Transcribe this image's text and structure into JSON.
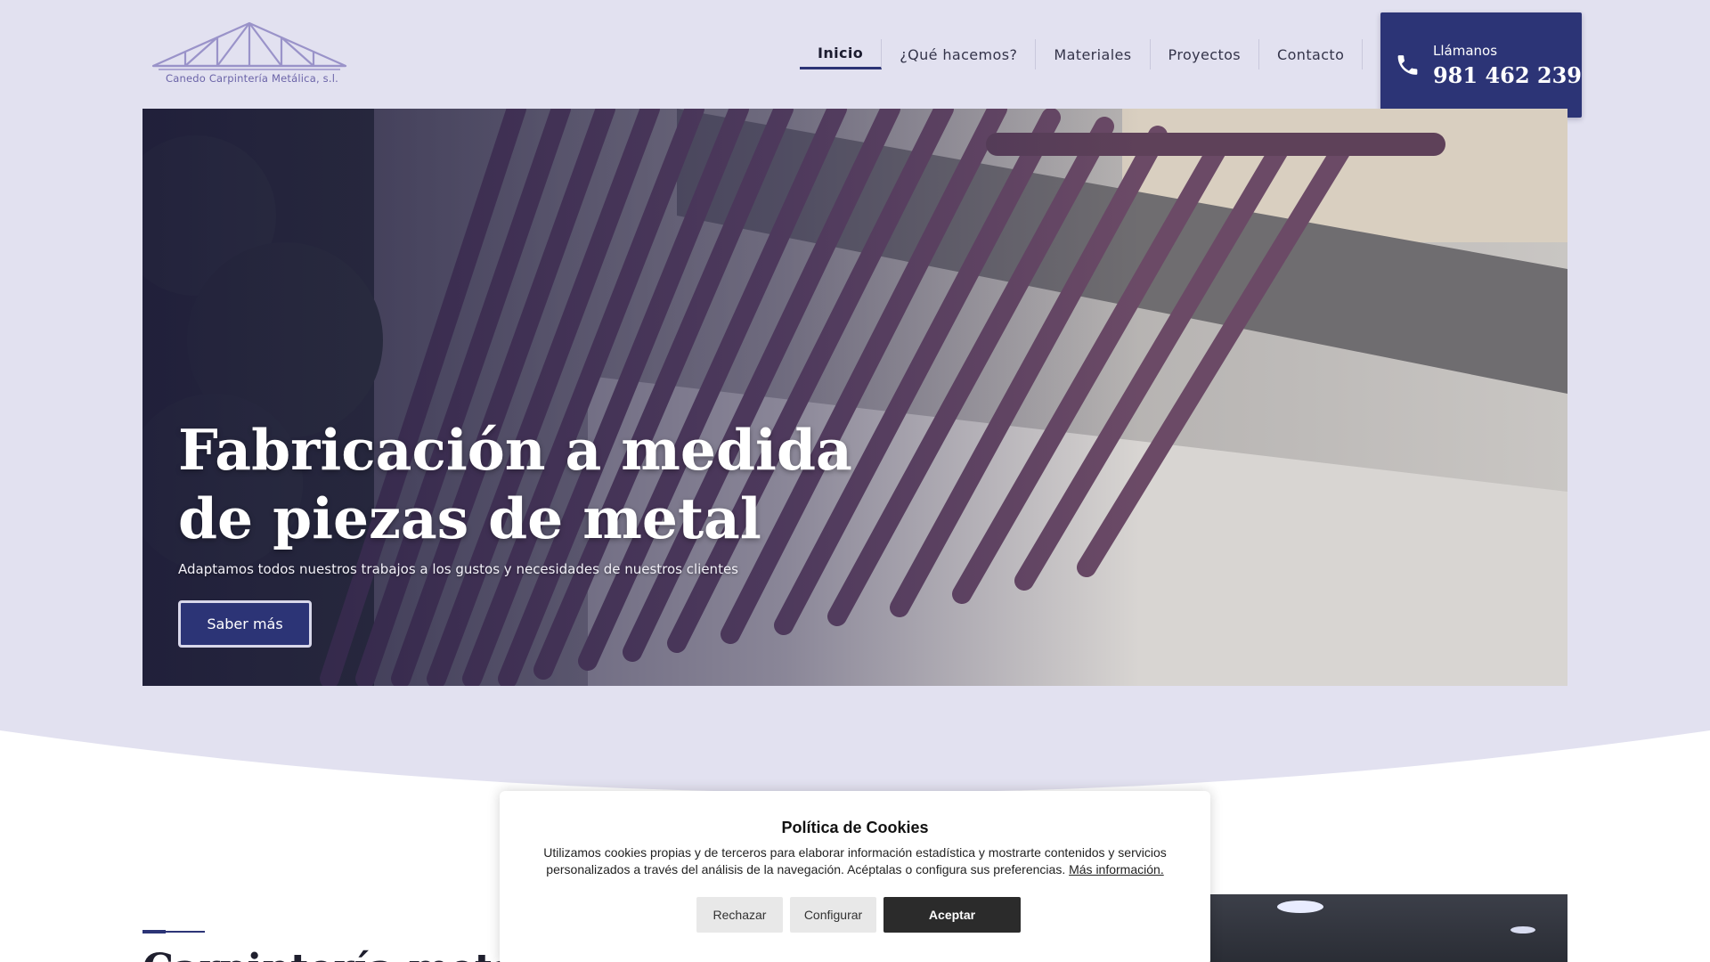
{
  "header": {
    "logo_text": "Canedo Carpintería Metálica, s.l.",
    "nav": [
      {
        "label": "Inicio",
        "active": true
      },
      {
        "label": "¿Qué hacemos?",
        "active": false
      },
      {
        "label": "Materiales",
        "active": false
      },
      {
        "label": "Proyectos",
        "active": false
      },
      {
        "label": "Contacto",
        "active": false
      }
    ],
    "call": {
      "icon": "phone-icon",
      "label": "Llámanos",
      "number": "981 462 239"
    }
  },
  "hero": {
    "title": "Fabricación a medida de piezas de metal",
    "subtitle": "Adaptamos todos nuestros trabajos a los gustos y necesidades de nuestros clientes",
    "button_label": "Saber más"
  },
  "section": {
    "heading": "Carpintería metálica"
  },
  "cookie_banner": {
    "title": "Política de Cookies",
    "text": "Utilizamos cookies propias y de terceros para elaborar información estadística y mostrarte contenidos y servicios personalizados a través del análisis de la navegación. Acéptalas o configura sus preferencias.",
    "more_info_link": "Más información.",
    "reject_label": "Rechazar",
    "configure_label": "Configurar",
    "accept_label": "Aceptar"
  },
  "colors": {
    "page_background": "#e2e1f0",
    "accent": "#2c3476",
    "logo": "#6b64a8",
    "accept_button": "#2b2b2b"
  }
}
